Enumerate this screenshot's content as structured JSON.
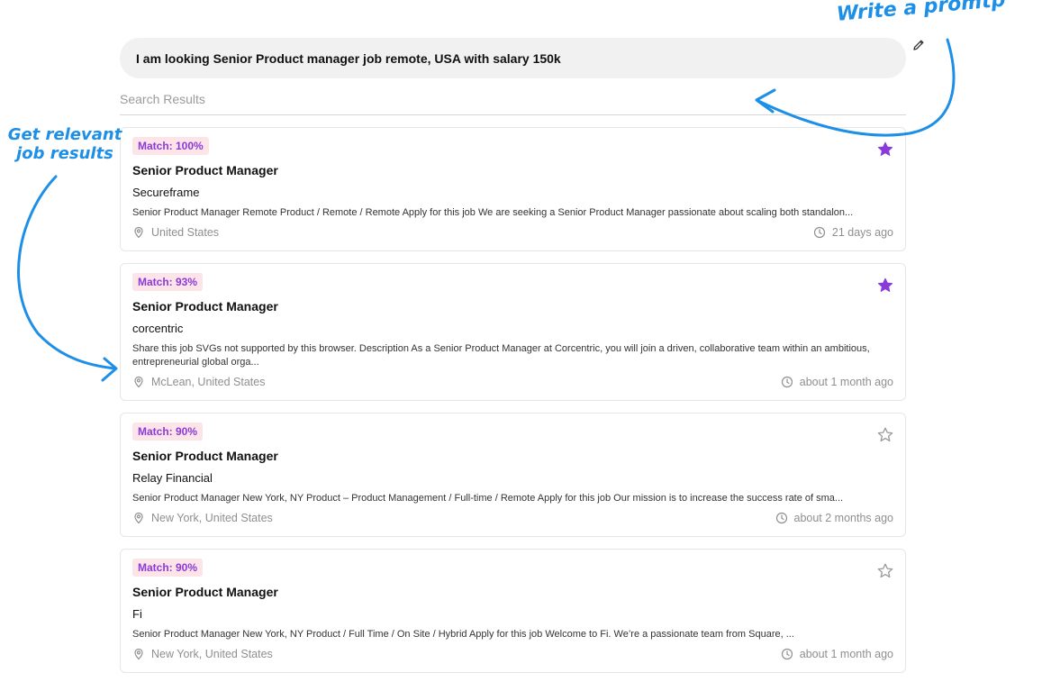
{
  "prompt": {
    "text": "I am looking Senior Product manager job remote, USA with salary 150k"
  },
  "results": {
    "label": "Search Results"
  },
  "annotations": {
    "prompt_note": "Write a promtp",
    "results_note_line1": "Get relevant",
    "results_note_line2": "job results"
  },
  "colors": {
    "accent_purple": "#8a3ad9",
    "badge_bg": "#fde4e8",
    "annotation_blue": "#1e8fe6",
    "star_filled": "#8a3ad9",
    "star_outline": "#9a9a9a"
  },
  "jobs": [
    {
      "match": "Match: 100%",
      "title": "Senior Product Manager",
      "company": "Secureframe",
      "description": "Senior Product Manager Remote Product / Remote / Remote Apply for this job We are seeking a Senior Product Manager passionate about scaling both standalon...",
      "location": "United States",
      "posted": "21 days ago",
      "starred": true
    },
    {
      "match": "Match: 93%",
      "title": "Senior Product Manager",
      "company": "corcentric",
      "description": "Share this job SVGs not supported by this browser. Description As a Senior Product Manager at Corcentric, you will join a driven, collaborative team within an ambitious, entrepreneurial global orga...",
      "location": "McLean, United States",
      "posted": "about 1 month ago",
      "starred": true
    },
    {
      "match": "Match: 90%",
      "title": "Senior Product Manager",
      "company": "Relay Financial",
      "description": "Senior Product Manager New York, NY Product – Product Management / Full-time / Remote Apply for this job Our mission is to increase the success rate of sma...",
      "location": "New York, United States",
      "posted": "about 2 months ago",
      "starred": false
    },
    {
      "match": "Match: 90%",
      "title": "Senior Product Manager",
      "company": "Fi",
      "description": "Senior Product Manager New York, NY Product / Full Time / On Site / Hybrid Apply for this job Welcome to Fi. We’re a passionate team from Square, ...",
      "location": "New York, United States",
      "posted": "about 1 month ago",
      "starred": false
    }
  ]
}
